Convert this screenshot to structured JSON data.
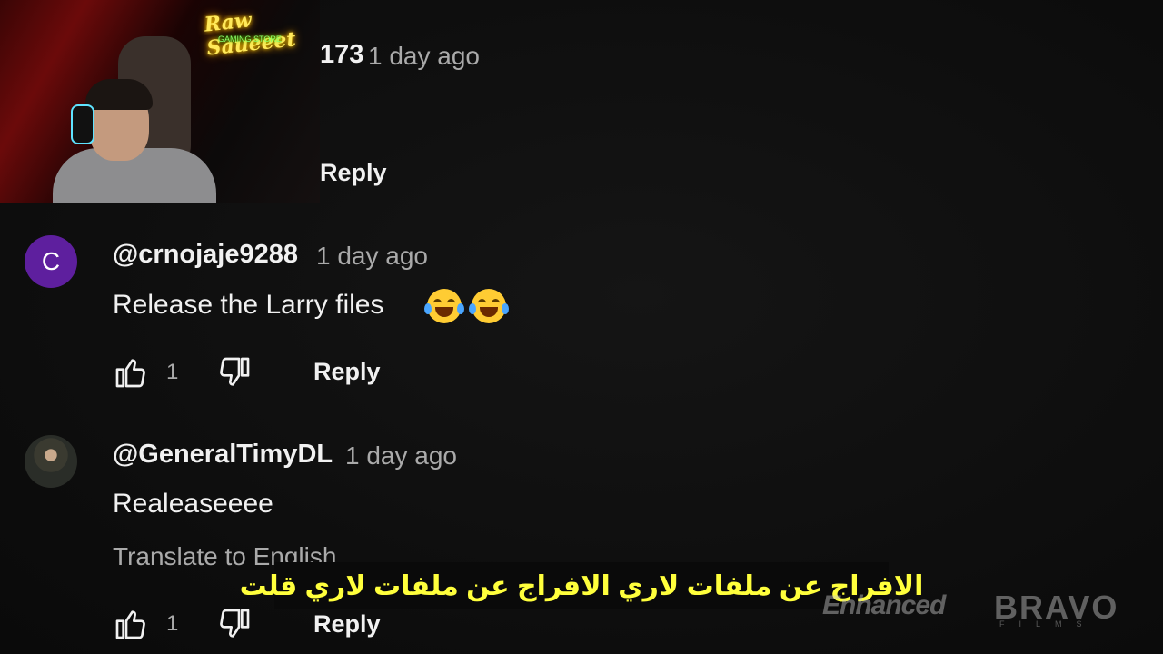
{
  "stream_overlay": {
    "neon_sign": "Raw Saueeet",
    "neon_sub": "GAMING STORE"
  },
  "comments": [
    {
      "username": "173",
      "time": "1 day ago",
      "reply_label": "Reply"
    },
    {
      "avatar_letter": "C",
      "avatar_color": "#5e1f9e",
      "username": "@crnojaje9288",
      "time": "1 day ago",
      "text": "Release the Larry files",
      "emoji": "face-with-tears-of-joy x2",
      "likes": "1",
      "reply_label": "Reply"
    },
    {
      "username": "@GeneralTimyDL",
      "time": "1 day ago",
      "text": "Realeaseeee",
      "translate_label": "Translate to English",
      "likes": "1",
      "reply_label": "Reply"
    }
  ],
  "subtitle": "الافراج عن ملفات لاري الافراج عن ملفات لاري قلت",
  "watermark": {
    "left": "Enhanced",
    "right": "BRAVO",
    "right_sub": "FILMS"
  },
  "colors": {
    "background": "#0f0f0f",
    "subtitle_text": "#ffff3c",
    "muted_text": "#aaaaaa"
  }
}
